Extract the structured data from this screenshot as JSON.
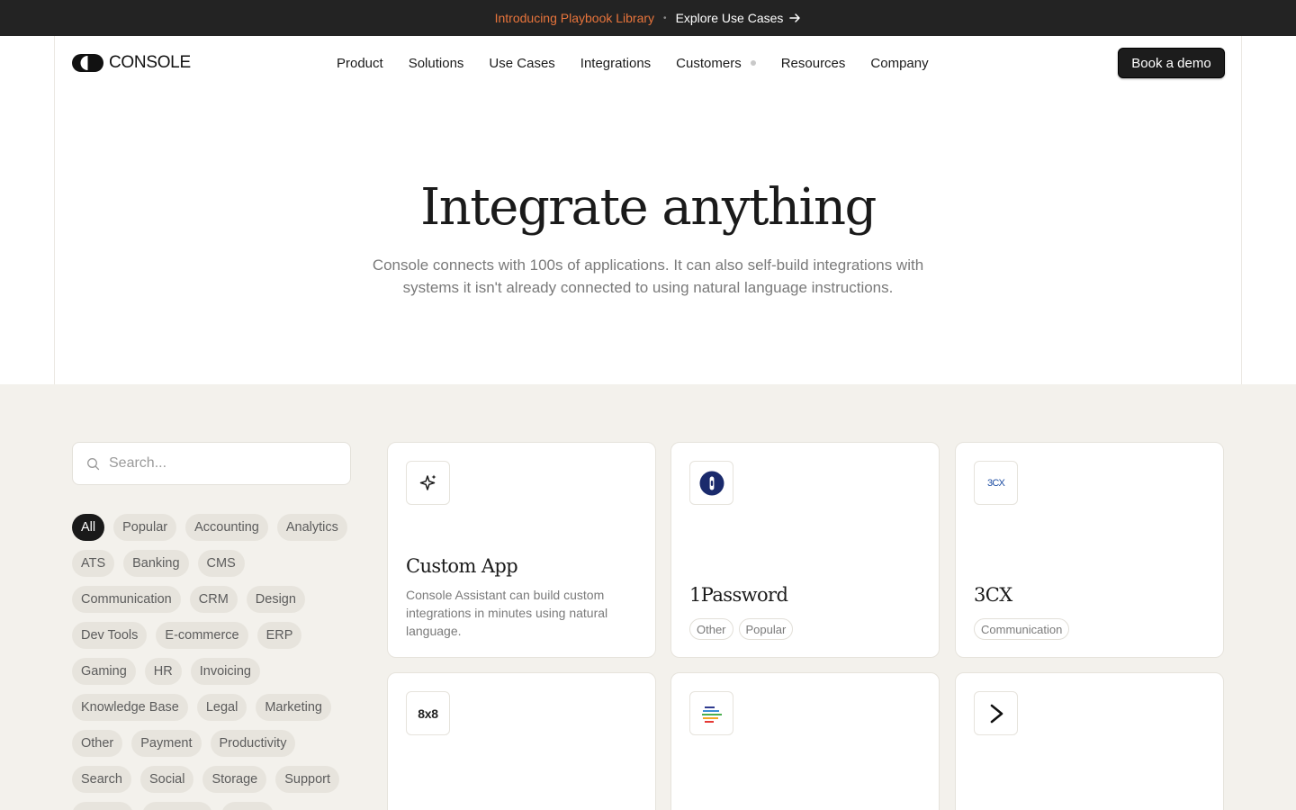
{
  "announcement": {
    "promo": "Introducing Playbook Library",
    "separator": "•",
    "link": "Explore Use Cases"
  },
  "header": {
    "logo_text": "CONSOLE",
    "nav": [
      "Product",
      "Solutions",
      "Use Cases",
      "Integrations",
      "Customers",
      "Resources",
      "Company"
    ],
    "cta": "Book a demo"
  },
  "hero": {
    "title": "Integrate anything",
    "subtitle": "Console connects with 100s of applications. It can also self-build integrations with systems it isn't already connected to using natural language instructions."
  },
  "search": {
    "placeholder": "Search..."
  },
  "filters": {
    "active": "All",
    "items": [
      "All",
      "Popular",
      "Accounting",
      "Analytics",
      "ATS",
      "Banking",
      "CMS",
      "Communication",
      "CRM",
      "Design",
      "Dev Tools",
      "E-commerce",
      "ERP",
      "Gaming",
      "HR",
      "Invoicing",
      "Knowledge Base",
      "Legal",
      "Marketing",
      "Other",
      "Payment",
      "Productivity",
      "Search",
      "Social",
      "Storage",
      "Support"
    ]
  },
  "cards": [
    {
      "title": "Custom App",
      "description": "Console Assistant can build custom integrations in minutes using natural language.",
      "icon": "sparkle-icon"
    },
    {
      "title": "1Password",
      "tags": [
        "Other",
        "Popular"
      ],
      "icon": "1password-logo"
    },
    {
      "title": "3CX",
      "tags": [
        "Communication"
      ],
      "icon": "3cx-logo",
      "icon_text": "3CX"
    },
    {
      "icon": "8x8-logo",
      "icon_text": "8x8"
    },
    {
      "icon": "colored-lines-logo"
    },
    {
      "icon": "chevron-right-logo"
    }
  ],
  "colors": {
    "announcement_bg": "#232323",
    "promo_text": "#e8743b",
    "lower_bg": "#f3f1ec",
    "active_chip": "#1a1a1a"
  }
}
